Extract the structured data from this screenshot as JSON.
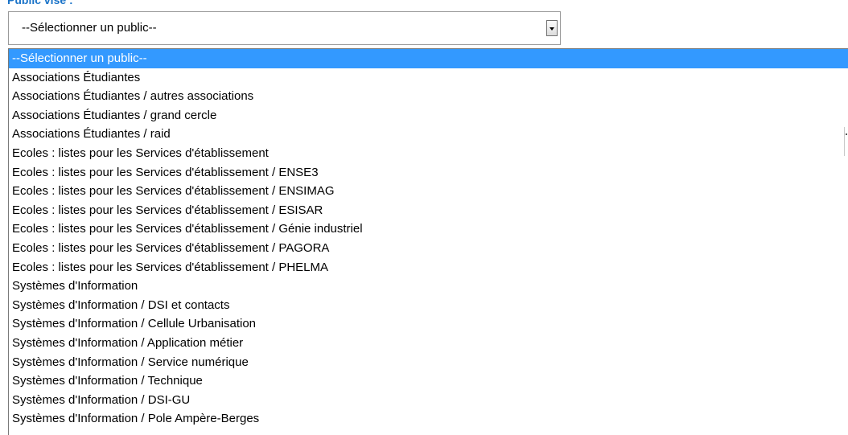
{
  "field": {
    "label": "Public visé :",
    "selected_value": "--Sélectionner un public--"
  },
  "options": [
    "--Sélectionner un public--",
    "Associations Étudiantes",
    "Associations Étudiantes / autres associations",
    "Associations Étudiantes / grand cercle",
    "Associations Étudiantes / raid",
    "Ecoles : listes pour les Services d'établissement",
    "Ecoles : listes pour les Services d'établissement / ENSE3",
    "Ecoles : listes pour les Services d'établissement / ENSIMAG",
    "Ecoles : listes pour les Services d'établissement / ESISAR",
    "Ecoles : listes pour les Services d'établissement / Génie industriel",
    "Ecoles : listes pour les Services d'établissement / PAGORA",
    "Ecoles : listes pour les Services d'établissement / PHELMA",
    "Systèmes d'Information",
    "Systèmes d'Information / DSI et contacts",
    "Systèmes d'Information / Cellule Urbanisation",
    "Systèmes d'Information / Application métier",
    "Systèmes d'Information / Service numérique",
    "Systèmes d'Information / Technique",
    "Systèmes d'Information / DSI-GU",
    "Systèmes d'Information / Pole Ampère-Berges"
  ],
  "highlighted_index": 0,
  "colors": {
    "label": "#1a73c8",
    "highlight": "#3399ff"
  }
}
